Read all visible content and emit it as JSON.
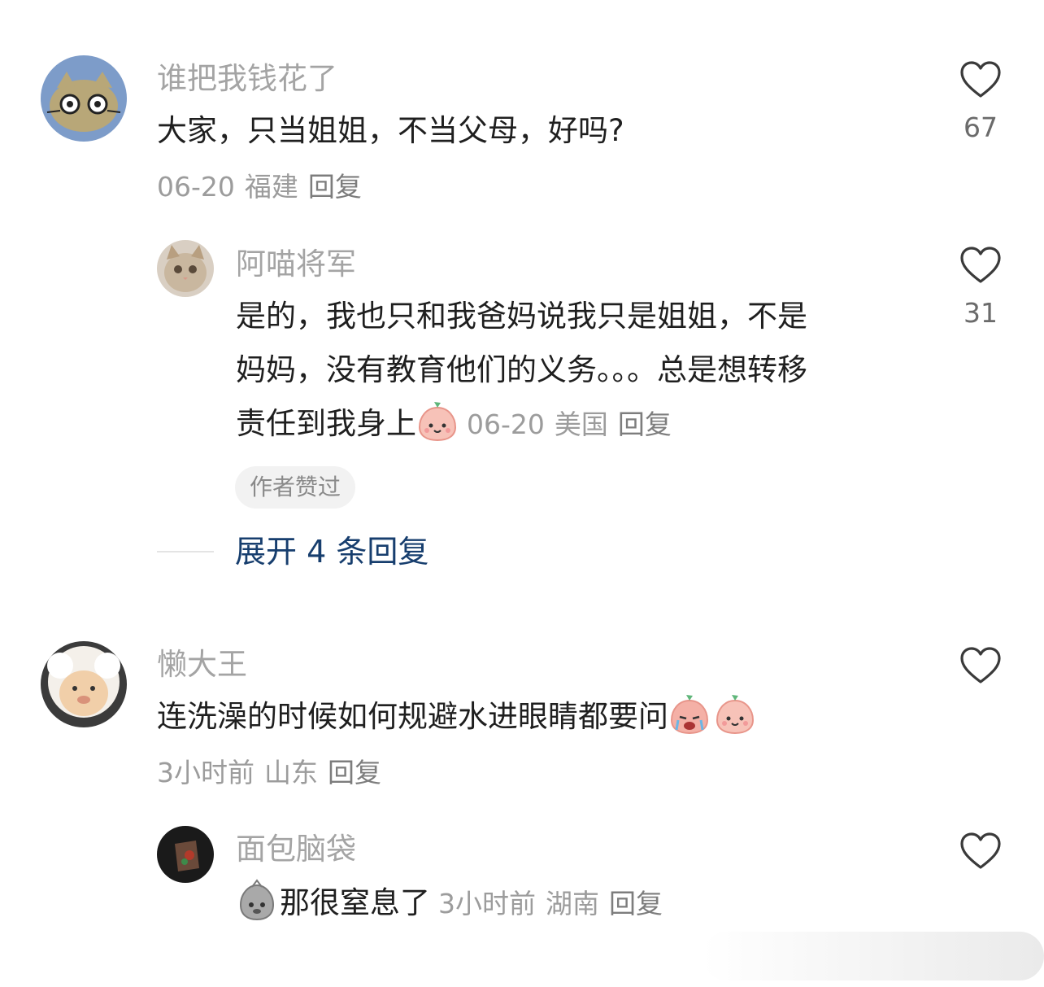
{
  "comments": [
    {
      "user": "谁把我钱花了",
      "text": "大家，只当姐姐，不当父母，好吗?",
      "date": "06-20",
      "location": "福建",
      "reply": "回复",
      "likes": "67"
    },
    {
      "user": "阿喵将军",
      "text_line1": "是的，我也只和我爸妈说我只是姐姐，不是",
      "text_line2": "妈妈，没有教育他们的义务。。。总是想转移",
      "text_line3": "责任到我身上",
      "date": "06-20",
      "location": "美国",
      "reply": "回复",
      "likes": "31",
      "badge": "作者赞过"
    },
    {
      "user": "懒大王",
      "text": "连洗澡的时候如何规避水进眼睛都要问",
      "date": "3小时前",
      "location": "山东",
      "reply": "回复"
    },
    {
      "user": "面包脑袋",
      "text": "那很窒息了",
      "date": "3小时前",
      "location": "湖南",
      "reply": "回复"
    }
  ],
  "expand_replies": "展开 4 条回复",
  "icons": {
    "like": "heart-outline-icon",
    "emoji_smile": "peach-smile-emoji",
    "emoji_cry": "peach-cry-emoji",
    "emoji_bag": "bag-face-emoji"
  },
  "colors": {
    "name": "#a4a4a4",
    "text": "#1f1f1f",
    "meta": "#9c9c9c",
    "expand": "#173e6e"
  }
}
